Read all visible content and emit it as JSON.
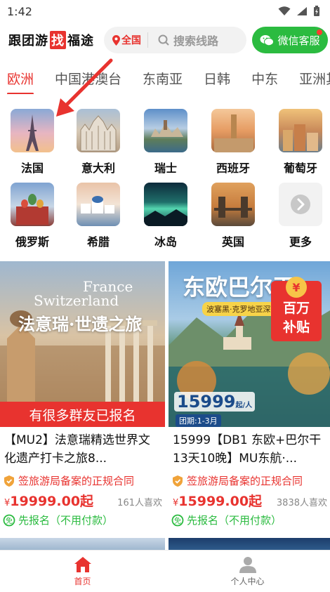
{
  "status": {
    "time": "1:42"
  },
  "header": {
    "logo_part1": "跟团游",
    "logo_highlight": "找",
    "logo_part2": "福途",
    "city": "全国",
    "search_placeholder": "搜索线路",
    "wechat_label": "微信客服"
  },
  "tabs": [
    "欧洲",
    "中国港澳台",
    "东南亚",
    "日韩",
    "中东",
    "亚洲其"
  ],
  "destinations": [
    "法国",
    "意大利",
    "瑞士",
    "西班牙",
    "葡萄牙",
    "俄罗斯",
    "希腊",
    "冰岛",
    "英国",
    "更多"
  ],
  "cards": [
    {
      "img_title_en": "France",
      "img_title_en2": "Switzerland",
      "img_title_cn": "法意瑞·世遗之旅",
      "banner": "有很多群友已报名",
      "title": "【MU2】法意瑞精选世界文化遗产打卡之旅8...",
      "guarantee": "签旅游局备案的正规合同",
      "price": "19999.00起",
      "likes": "161人喜欢",
      "signup": "先报名（不用付款）"
    },
    {
      "img_title_cn": "东欧巴尔干",
      "img_subtitle": "波塞黑·克罗地亚深度13",
      "subsidy_line1": "百万",
      "subsidy_line2": "补贴",
      "img_price": "15999",
      "img_price_unit": "起/人",
      "img_date": "团期:1-3月",
      "title": "15999【DB1 东欧+巴尔干13天10晚】MU东航·...",
      "guarantee": "签旅游局备案的正规合同",
      "price": "15999.00起",
      "likes": "3838人喜欢",
      "signup": "先报名（不用付款）"
    }
  ],
  "bottom_nav": {
    "home": "首页",
    "profile": "个人中心"
  },
  "colors": {
    "accent": "#e8332f",
    "wechat": "#2bbb40"
  }
}
